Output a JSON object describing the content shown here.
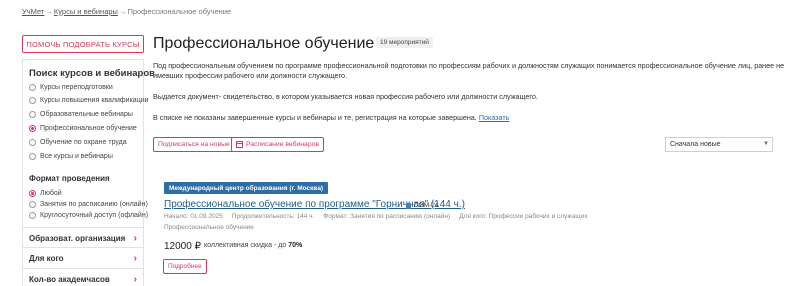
{
  "breadcrumb": {
    "home": "УчМет",
    "section": "Курсы и вебинары",
    "current": "Профессиональное обучение",
    "separator": "→"
  },
  "sidebar": {
    "help_button": "ПОМОЧЬ ПОДОБРАТЬ КУРСЫ",
    "search_title": "Поиск курсов и вебинаров",
    "course_types": [
      {
        "label": "Курсы переподготовки",
        "selected": false
      },
      {
        "label": "Курсы повышения квалификации",
        "selected": false
      },
      {
        "label": "Образовательные вебинары",
        "selected": false
      },
      {
        "label": "Профессиональное обучение",
        "selected": true
      },
      {
        "label": "Обучение по охране труда",
        "selected": false
      },
      {
        "label": "Все курсы и вебинары",
        "selected": false
      }
    ],
    "format_title": "Формат проведения",
    "formats": [
      {
        "label": "Любой",
        "selected": true
      },
      {
        "label": "Занятия по расписанию (онлайн)",
        "selected": false
      },
      {
        "label": "Круглосуточный доступ (офлайн)",
        "selected": false
      }
    ],
    "filters": [
      {
        "label": "Образоват. организация"
      },
      {
        "label": "Для кого"
      },
      {
        "label": "Кол-во академчасов"
      }
    ],
    "chevron": "›"
  },
  "main": {
    "title": "Профессиональное обучение",
    "count_badge": "19 мероприятий",
    "description": "Под профессиональным обучением по программе профессиональной подготовки по профессиям рабочих и должностям служащих понимается профессиональное обучение лиц, ранее не имевших профессии рабочего или должности служащего.",
    "document_note": "Выдается документ- свидетельство, в котором указывается новая профессия рабочего или должности служащего.",
    "hidden_note": "В списке не показаны завершенные курсы и вебинары и те, регистрация на которые завершена.",
    "show_link": "Показать",
    "subscribe_button": "Подписаться на новые",
    "schedule_button": "Расписание вебинаров",
    "sort": {
      "selected": "Сначала новые"
    }
  },
  "course": {
    "org_badge": "Международный центр образования (г. Москва)",
    "title": "Профессиональное обучение по программе \"Горничная\" (144 ч.)",
    "code": "ПОМ-24",
    "start": "Начало: 01.09.2025",
    "duration": "Продолжительность: 144 ч.",
    "format": "Формат: Занятия по расписанию (онлайн)",
    "audience": "Для кого: Профессии рабочих и служащих",
    "category": "Профессиональное обучение",
    "price": "12000 ₽",
    "discount_text": "коллективная скидка - до",
    "discount_value": "70%",
    "more_button": "Подробнее"
  },
  "colors": {
    "accent": "#d63a5b",
    "link": "#1f5c8f",
    "badge": "#2d6da8"
  }
}
